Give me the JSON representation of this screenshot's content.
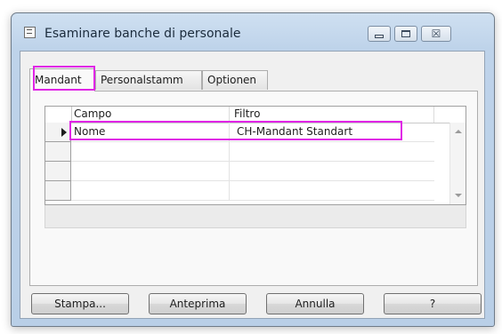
{
  "window": {
    "title": "Esaminare banche di personale",
    "caption_buttons": [
      "minimize",
      "maximize",
      "close"
    ],
    "close_glyph": "☒"
  },
  "tabs": [
    {
      "label": "Mandant",
      "active": true
    },
    {
      "label": "Personalstamm",
      "active": false
    },
    {
      "label": "Optionen",
      "active": false
    }
  ],
  "grid": {
    "columns": [
      "Campo",
      "Filtro"
    ],
    "rows": [
      {
        "campo": "Nome",
        "filtro": "CH-Mandant Standart",
        "current": true
      },
      {
        "campo": "",
        "filtro": "",
        "current": false
      },
      {
        "campo": "",
        "filtro": "",
        "current": false
      },
      {
        "campo": "",
        "filtro": "",
        "current": false
      }
    ]
  },
  "buttons": {
    "stampa": "Stampa...",
    "anteprima": "Anteprima",
    "annulla": "Annulla",
    "help": "?"
  },
  "colors": {
    "highlight": "#e025e6",
    "titlebar": "#bed3ea"
  }
}
